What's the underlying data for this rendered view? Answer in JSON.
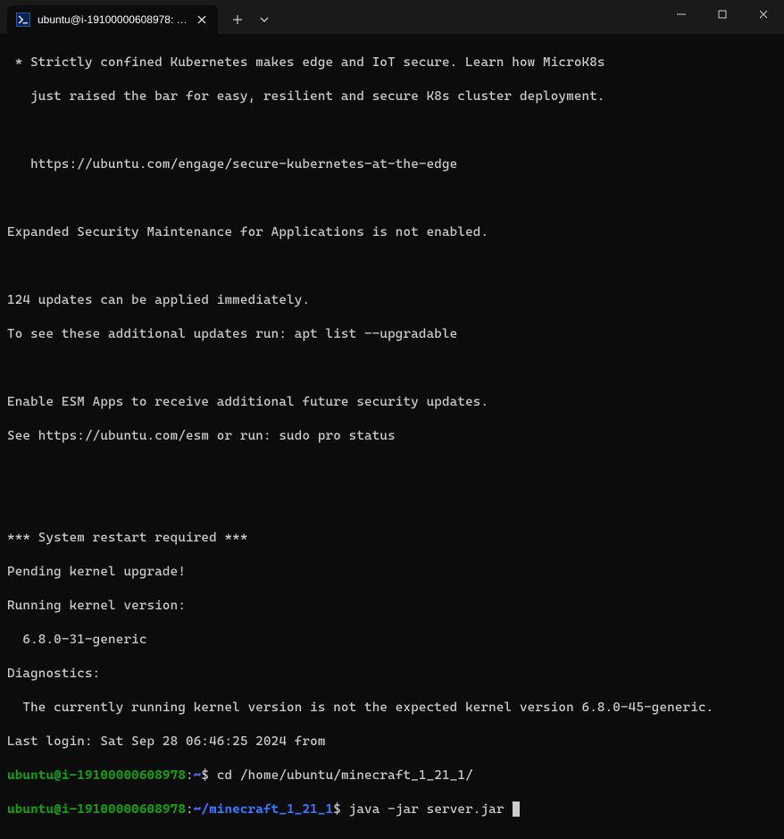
{
  "titlebar": {
    "tab_title": "ubuntu@i-19100000608978: ~/…",
    "tab_icon_glyph": ">_"
  },
  "motd": {
    "bullet": " * Strictly confined Kubernetes makes edge and IoT secure. Learn how MicroK8s",
    "bullet2": "   just raised the bar for easy, resilient and secure K8s cluster deployment.",
    "url": "   https://ubuntu.com/engage/secure-kubernetes-at-the-edge",
    "esm": "Expanded Security Maintenance for Applications is not enabled.",
    "updates": "124 updates can be applied immediately.",
    "updates2": "To see these additional updates run: apt list --upgradable",
    "esm2": "Enable ESM Apps to receive additional future security updates.",
    "esm3": "See https://ubuntu.com/esm or run: sudo pro status",
    "restart": "*** System restart required ***",
    "kernel1": "Pending kernel upgrade!",
    "kernel2": "Running kernel version:",
    "kernel3": "  6.8.0-31-generic",
    "diag": "Diagnostics:",
    "diag2": "  The currently running kernel version is not the expected kernel version 6.8.0-45-generic.",
    "lastlogin_prefix": "Last login: Sat Sep 28 06:46:25 2024 from "
  },
  "prompt1": {
    "userhost": "ubuntu@i-19100000608978",
    "sep": ":",
    "path": "~",
    "dollar": "$ ",
    "cmd": "cd /home/ubuntu/minecraft_1_21_1/"
  },
  "prompt2": {
    "userhost": "ubuntu@i-19100000608978",
    "sep": ":",
    "path": "~/minecraft_1_21_1",
    "dollar": "$ ",
    "cmd": "java -jar server.jar "
  }
}
